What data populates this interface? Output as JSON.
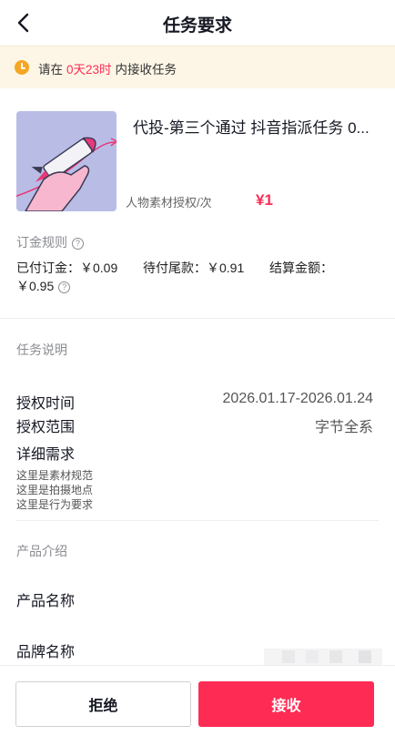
{
  "header": {
    "title": "任务要求"
  },
  "banner": {
    "prefix": "请在",
    "countdown": "0天23时",
    "suffix": "内接收任务"
  },
  "task": {
    "name": "代投-第三个通过 抖音指派任务 0...",
    "unit": "人物素材授权/次",
    "price": "¥1"
  },
  "deposit": {
    "title": "订金规则",
    "paid": "已付订金：￥0.09",
    "pending": "待付尾款：￥0.91",
    "settlement_label": "结算金额：",
    "settlement_value": "￥0.95"
  },
  "description": {
    "title": "任务说明",
    "auth_time_label": "授权时间",
    "auth_time_value": "2026.01.17-2026.01.24",
    "auth_scope_label": "授权范围",
    "auth_scope_value": "字节全系",
    "detail_label": "详细需求",
    "detail_lines": [
      "这里是素材规范",
      "这里是拍摄地点",
      "这里是行为要求"
    ]
  },
  "product": {
    "title": "产品介绍",
    "name_label": "产品名称",
    "brand_label": "品牌名称"
  },
  "footer": {
    "reject": "拒绝",
    "accept": "接收"
  },
  "colors": {
    "accent": "#fe2c55",
    "banner_bg": "#fdf6e6",
    "clock": "#f5a623"
  }
}
